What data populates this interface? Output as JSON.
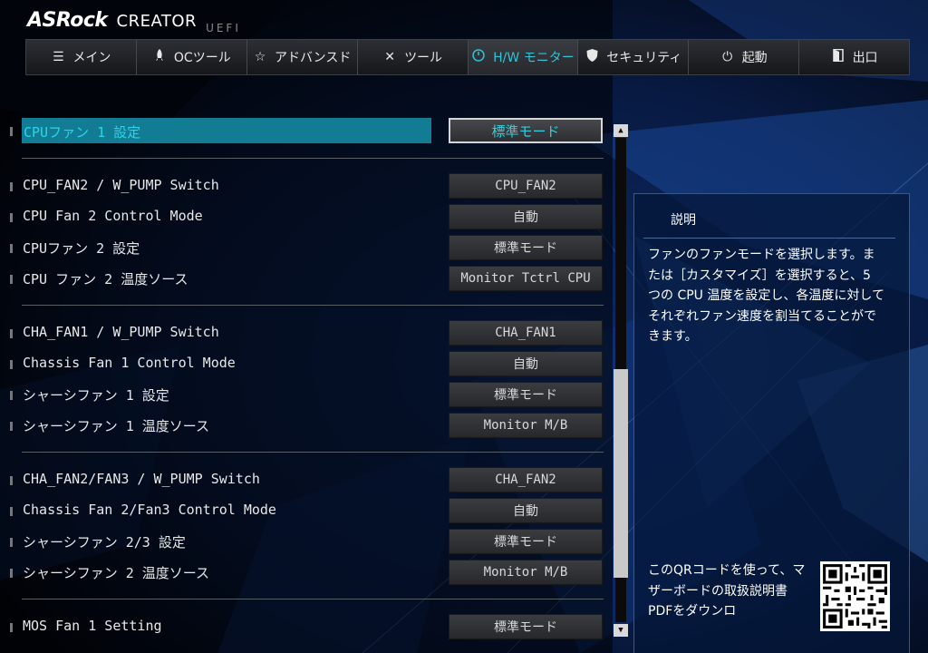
{
  "brand": {
    "name": "ASRock",
    "product": "CREATOR",
    "firmware": "UEFI"
  },
  "tabs": [
    {
      "label": "メイン",
      "icon": "list-icon",
      "active": false
    },
    {
      "label": "OCツール",
      "icon": "rocket-icon",
      "active": false
    },
    {
      "label": "アドバンスド",
      "icon": "star-icon",
      "active": false
    },
    {
      "label": "ツール",
      "icon": "tools-icon",
      "active": false
    },
    {
      "label": "H/W モニター",
      "icon": "monitor-icon",
      "active": true
    },
    {
      "label": "セキュリティ",
      "icon": "shield-icon",
      "active": false
    },
    {
      "label": "起動",
      "icon": "power-icon",
      "active": false
    },
    {
      "label": "出口",
      "icon": "exit-icon",
      "active": false
    }
  ],
  "settings": [
    {
      "label": "CPUファン 1 設定",
      "value": "標準モード",
      "selected": true
    },
    {
      "label": "CPU_FAN2 / W_PUMP Switch",
      "value": "CPU_FAN2"
    },
    {
      "label": "CPU Fan 2 Control Mode",
      "value": "自動"
    },
    {
      "label": "CPUファン 2 設定",
      "value": "標準モード"
    },
    {
      "label": "CPU ファン 2 温度ソース",
      "value": "Monitor Tctrl CPU"
    },
    {
      "label": "CHA_FAN1 / W_PUMP Switch",
      "value": "CHA_FAN1"
    },
    {
      "label": "Chassis Fan 1 Control Mode",
      "value": "自動"
    },
    {
      "label": "シャーシファン 1 設定",
      "value": "標準モード"
    },
    {
      "label": "シャーシファン 1 温度ソース",
      "value": "Monitor M/B"
    },
    {
      "label": "CHA_FAN2/FAN3 / W_PUMP Switch",
      "value": "CHA_FAN2"
    },
    {
      "label": "Chassis Fan 2/Fan3 Control Mode",
      "value": "自動"
    },
    {
      "label": "シャーシファン 2/3 設定",
      "value": "標準モード"
    },
    {
      "label": "シャーシファン 2 温度ソース",
      "value": "Monitor M/B"
    },
    {
      "label": "MOS Fan 1 Setting",
      "value": "標準モード"
    }
  ],
  "help": {
    "title": "説明",
    "text": "ファンのファンモードを選択します。または［カスタマイズ］を選択すると、5 つの CPU 温度を設定し、各温度に対してそれぞれファン速度を割当てることができます。",
    "qr_text": "このQRコードを使って、マザーボードの取扱説明書PDFをダウンロ"
  },
  "scrollbar": {
    "up_icon": "arrow-up-icon",
    "down_icon": "arrow-down-icon"
  }
}
